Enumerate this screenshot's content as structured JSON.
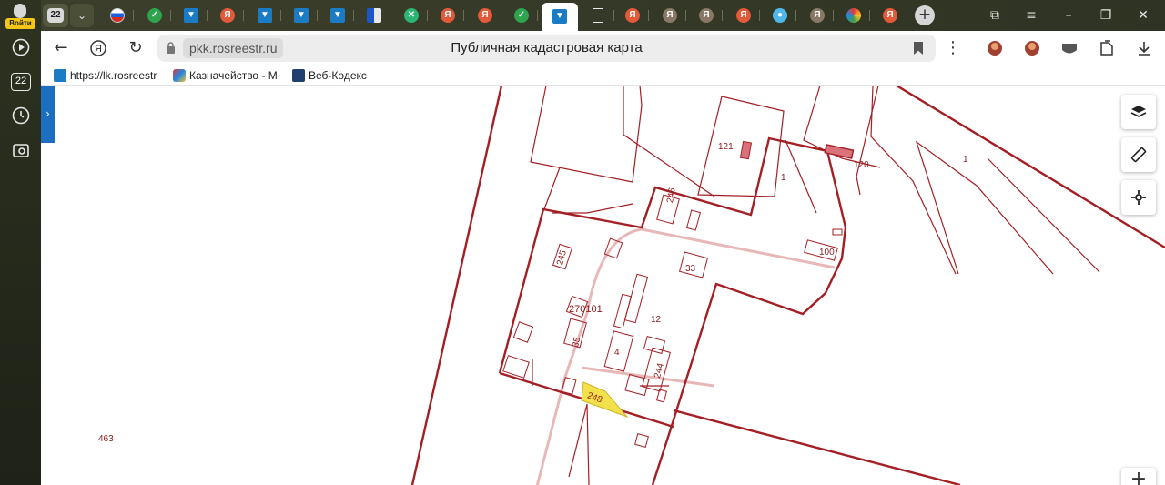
{
  "sidebar": {
    "login_label": "Войти",
    "tab_count_badge": "22"
  },
  "tabbar": {
    "tab_count": "22",
    "active_index": 12
  },
  "toolbar": {
    "url": "pkk.rosreestr.ru",
    "page_title": "Публичная кадастровая карта"
  },
  "bookmarks": [
    {
      "label": "https://lk.rosreestr"
    },
    {
      "label": "Казначейство - М"
    },
    {
      "label": "Веб-Кодекс"
    }
  ],
  "map": {
    "labels": {
      "l121": "121",
      "l1a": "1",
      "l120": "120",
      "l1b": "1",
      "l246": "246",
      "l100": "100",
      "l245": "245",
      "l33": "33",
      "l270101": "270101",
      "l12": "12",
      "l35": "35",
      "l4": "4",
      "l244": "244",
      "l248": "248",
      "l463": "463"
    }
  },
  "colors": {
    "parcel_line": "#a31f24",
    "road_line": "#e8b8b8",
    "highlight_fill": "#f2e14a"
  }
}
